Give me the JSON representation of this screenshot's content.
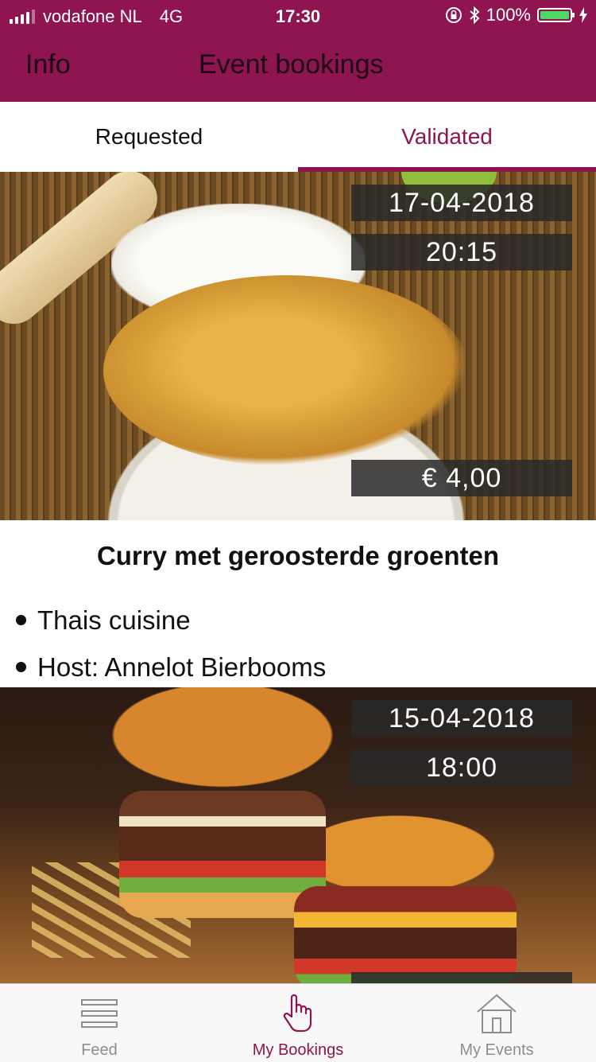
{
  "status_bar": {
    "carrier": "vodafone NL",
    "network": "4G",
    "time": "17:30",
    "battery": "100%"
  },
  "nav": {
    "back_label": "Info",
    "title": "Event bookings"
  },
  "tabs": [
    {
      "label": "Requested",
      "active": false
    },
    {
      "label": "Validated",
      "active": true
    }
  ],
  "bookings": [
    {
      "date": "17-04-2018",
      "time": "20:15",
      "price": "€ 4,00",
      "title": "Curry met geroosterde groenten",
      "details": [
        "Thais cuisine",
        "Host: Annelot Bierbooms"
      ]
    },
    {
      "date": "15-04-2018",
      "time": "18:00"
    }
  ],
  "tabbar": {
    "items": [
      {
        "label": "Feed",
        "icon": "list-icon",
        "active": false
      },
      {
        "label": "My Bookings",
        "icon": "hand-pointer-icon",
        "active": true
      },
      {
        "label": "My Events",
        "icon": "house-icon",
        "active": false
      }
    ]
  },
  "colors": {
    "brand": "#8e1550",
    "tab_inactive": "#8e8e8e",
    "battery": "#4cd964"
  }
}
